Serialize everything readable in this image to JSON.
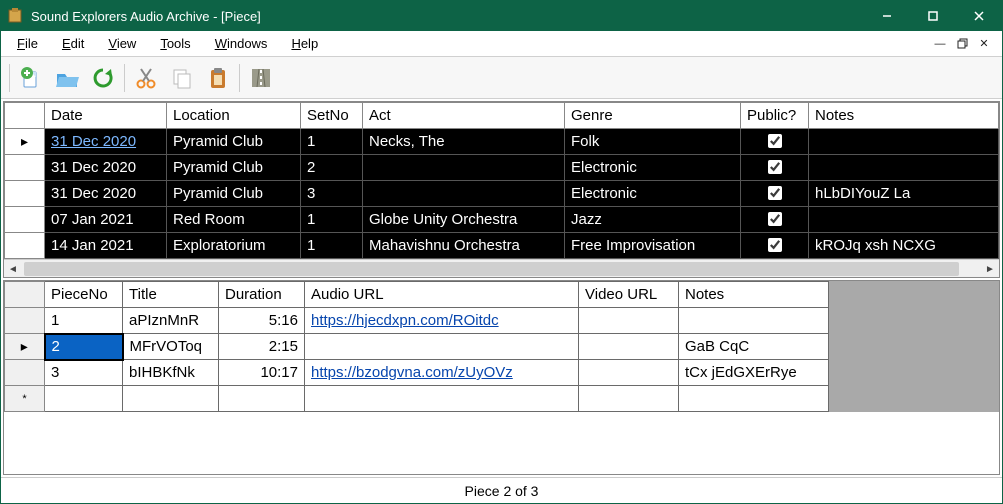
{
  "window": {
    "title": "Sound Explorers Audio Archive - [Piece]"
  },
  "menus": {
    "file": "File",
    "edit": "Edit",
    "view": "View",
    "tools": "Tools",
    "windows": "Windows",
    "help": "Help"
  },
  "top_headers": [
    "Date",
    "Location",
    "SetNo",
    "Act",
    "Genre",
    "Public?",
    "Notes"
  ],
  "top_rows": [
    {
      "date": "31 Dec 2020",
      "date_link": true,
      "location": "Pyramid Club",
      "setno": "1",
      "act": "Necks, The",
      "genre": "Folk",
      "public": true,
      "notes": "",
      "arrow": true
    },
    {
      "date": "31 Dec 2020",
      "location": "Pyramid Club",
      "setno": "2",
      "act": "",
      "genre": "Electronic",
      "public": true,
      "notes": ""
    },
    {
      "date": "31 Dec 2020",
      "location": "Pyramid Club",
      "setno": "3",
      "act": "",
      "genre": "Electronic",
      "public": true,
      "notes": "hLbDIYouZ La"
    },
    {
      "date": "07 Jan 2021",
      "location": "Red Room",
      "setno": "1",
      "act": "Globe Unity Orchestra",
      "genre": "Jazz",
      "public": true,
      "notes": ""
    },
    {
      "date": "14 Jan 2021",
      "location": "Exploratorium",
      "setno": "1",
      "act": "Mahavishnu Orchestra",
      "genre": "Free Improvisation",
      "public": true,
      "notes": "kROJq xsh NCXG"
    }
  ],
  "bot_headers": [
    "PieceNo",
    "Title",
    "Duration",
    "Audio URL",
    "Video URL",
    "Notes"
  ],
  "bot_rows": [
    {
      "pieceno": "1",
      "title": "aPIznMnR",
      "duration": "5:16",
      "audio": "https://hjecdxpn.com/ROitdc",
      "video": "",
      "notes": ""
    },
    {
      "pieceno": "2",
      "title": "MFrVOToq",
      "duration": "2:15",
      "audio": "",
      "video": "",
      "notes": "GaB CqC",
      "selected": true,
      "arrow": true
    },
    {
      "pieceno": "3",
      "title": "bIHBKfNk",
      "duration": "10:17",
      "audio": "https://bzodgvna.com/zUyOVz",
      "video": "",
      "notes": "tCx jEdGXErRye"
    }
  ],
  "status": "Piece 2 of 3"
}
